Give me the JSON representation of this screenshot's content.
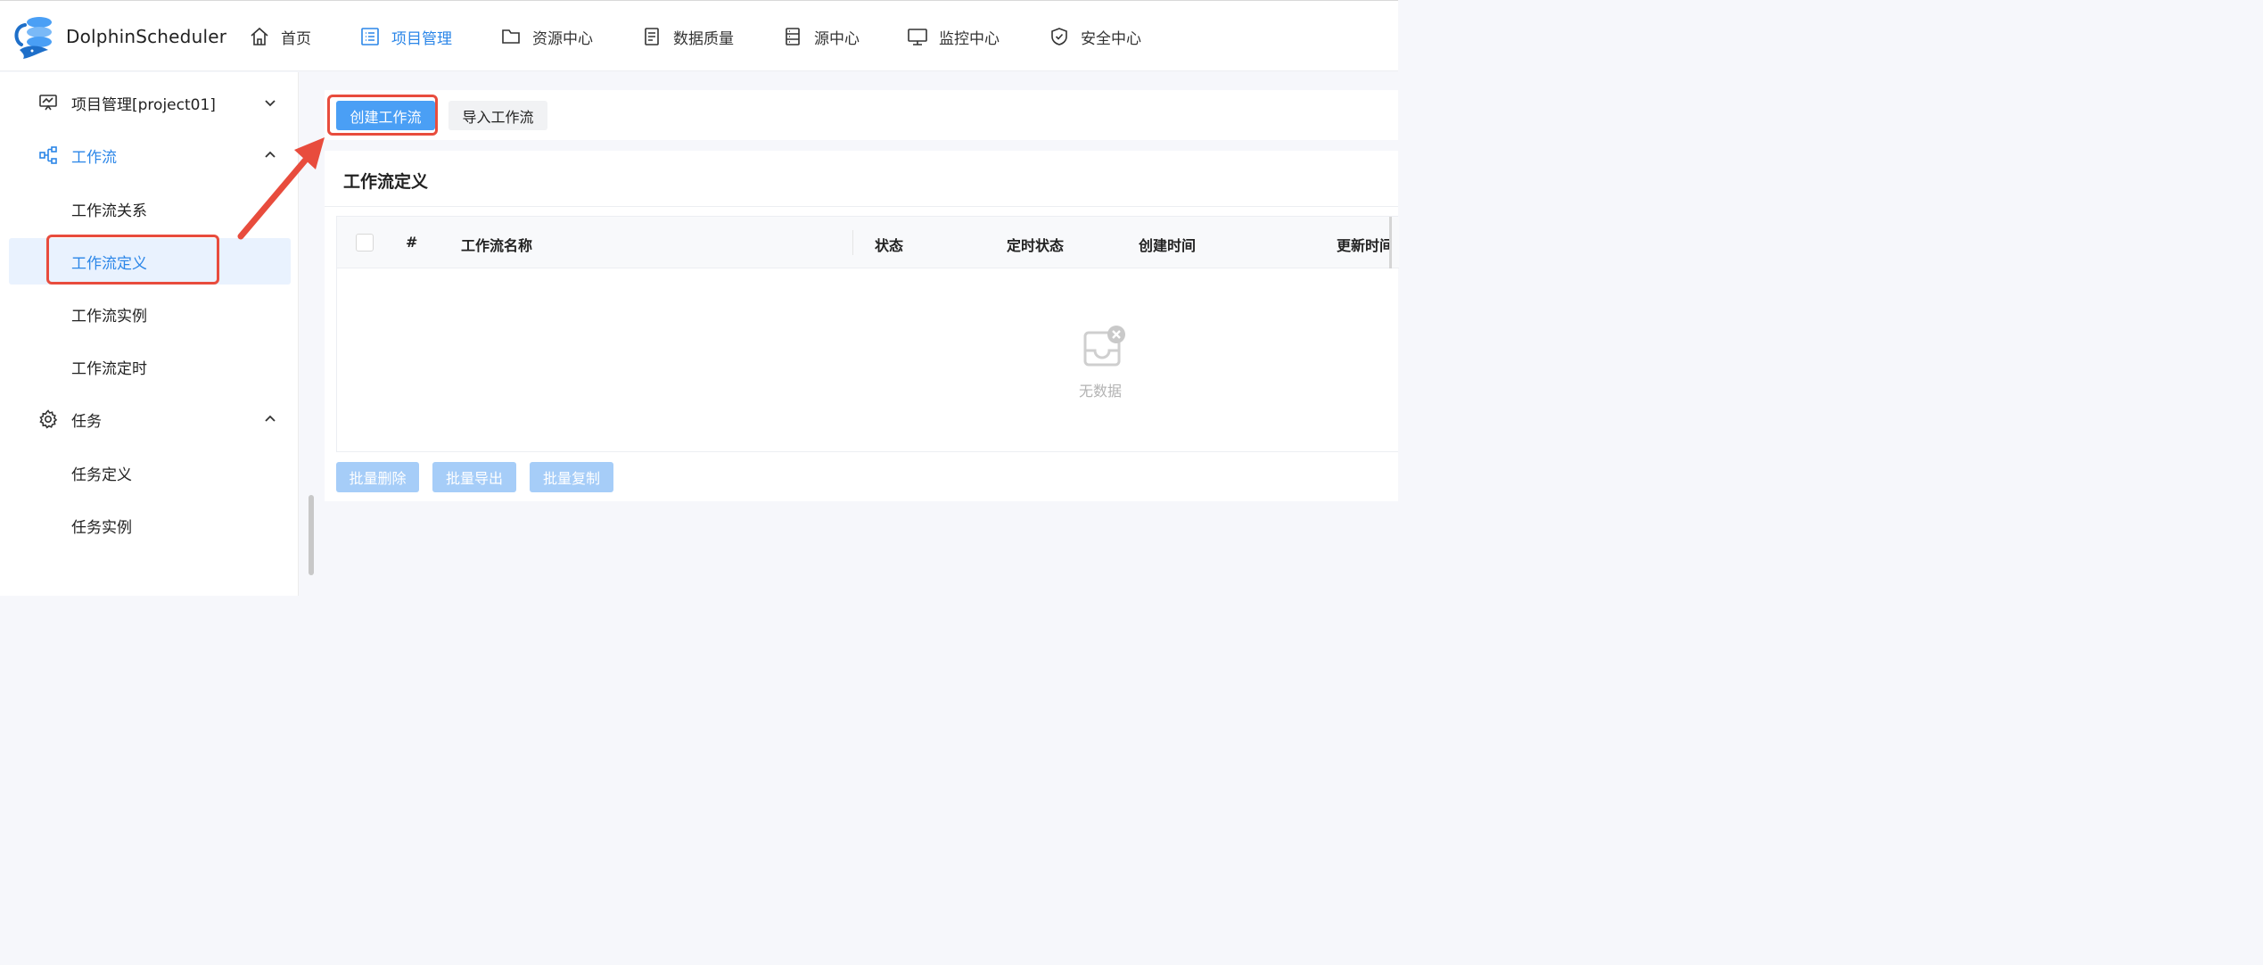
{
  "app": {
    "brand": "DolphinScheduler"
  },
  "topnav": [
    {
      "label": "首页",
      "icon": "home-icon"
    },
    {
      "label": "项目管理",
      "icon": "project-list-icon",
      "active": true
    },
    {
      "label": "资源中心",
      "icon": "folder-icon"
    },
    {
      "label": "数据质量",
      "icon": "document-icon"
    },
    {
      "label": "源中心",
      "icon": "server-icon"
    },
    {
      "label": "监控中心",
      "icon": "monitor-icon"
    },
    {
      "label": "安全中心",
      "icon": "shield-icon"
    }
  ],
  "sidebar": {
    "project": {
      "label": "项目管理[project01]",
      "icon": "presentation-chart-icon"
    },
    "workflow": {
      "label": "工作流",
      "icon": "workflow-icon"
    },
    "workflow_items": [
      "工作流关系",
      "工作流定义",
      "工作流实例",
      "工作流定时"
    ],
    "task": {
      "label": "任务",
      "icon": "gear-icon"
    },
    "task_items": [
      "任务定义",
      "任务实例"
    ]
  },
  "toolbar": {
    "create_label": "创建工作流",
    "import_label": "导入工作流"
  },
  "card": {
    "title": "工作流定义"
  },
  "table": {
    "columns": [
      "#",
      "工作流名称",
      "状态",
      "定时状态",
      "创建时间",
      "更新时间"
    ],
    "empty_text": "无数据"
  },
  "batch": {
    "delete_label": "批量删除",
    "export_label": "批量导出",
    "copy_label": "批量复制"
  },
  "colors": {
    "accent": "#2b86e8",
    "annotation": "#e84c3d"
  }
}
